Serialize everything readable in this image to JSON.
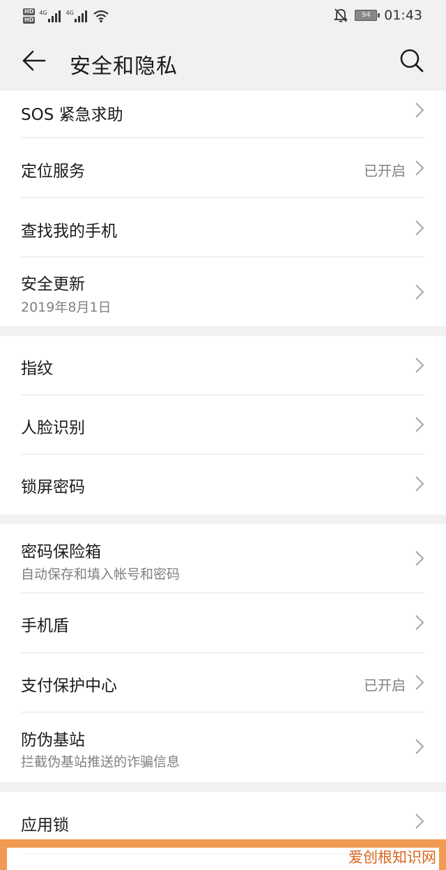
{
  "status_bar": {
    "hd1": "HD",
    "hd2": "HD",
    "net1": "4G",
    "net2": "4G",
    "battery": "94",
    "time": "01:43",
    "icons": [
      "signal-icon",
      "wifi-icon",
      "bell-off-icon",
      "battery-icon"
    ]
  },
  "header": {
    "title": "安全和隐私",
    "back_icon": "arrow-left-icon",
    "search_icon": "search-icon"
  },
  "groups": [
    {
      "items": [
        {
          "label": "SOS 紧急求助",
          "sub": "",
          "value": ""
        },
        {
          "label": "定位服务",
          "sub": "",
          "value": "已开启"
        },
        {
          "label": "查找我的手机",
          "sub": "",
          "value": ""
        },
        {
          "label": "安全更新",
          "sub": "2019年8月1日",
          "value": ""
        }
      ]
    },
    {
      "items": [
        {
          "label": "指纹",
          "sub": "",
          "value": ""
        },
        {
          "label": "人脸识别",
          "sub": "",
          "value": ""
        },
        {
          "label": "锁屏密码",
          "sub": "",
          "value": ""
        }
      ]
    },
    {
      "items": [
        {
          "label": "密码保险箱",
          "sub": "自动保存和填入帐号和密码",
          "value": ""
        },
        {
          "label": "手机盾",
          "sub": "",
          "value": ""
        },
        {
          "label": "支付保护中心",
          "sub": "",
          "value": "已开启"
        },
        {
          "label": "防伪基站",
          "sub": "拦截伪基站推送的诈骗信息",
          "value": ""
        }
      ]
    },
    {
      "items": [
        {
          "label": "应用锁",
          "sub": "",
          "value": ""
        }
      ]
    }
  ],
  "watermark": {
    "brand": "爱创根",
    "suffix": "知识网"
  },
  "colors": {
    "background": "#f1f1f1",
    "card": "#ffffff",
    "secondary_text": "#808080",
    "watermark_orange": "#f09a52"
  }
}
